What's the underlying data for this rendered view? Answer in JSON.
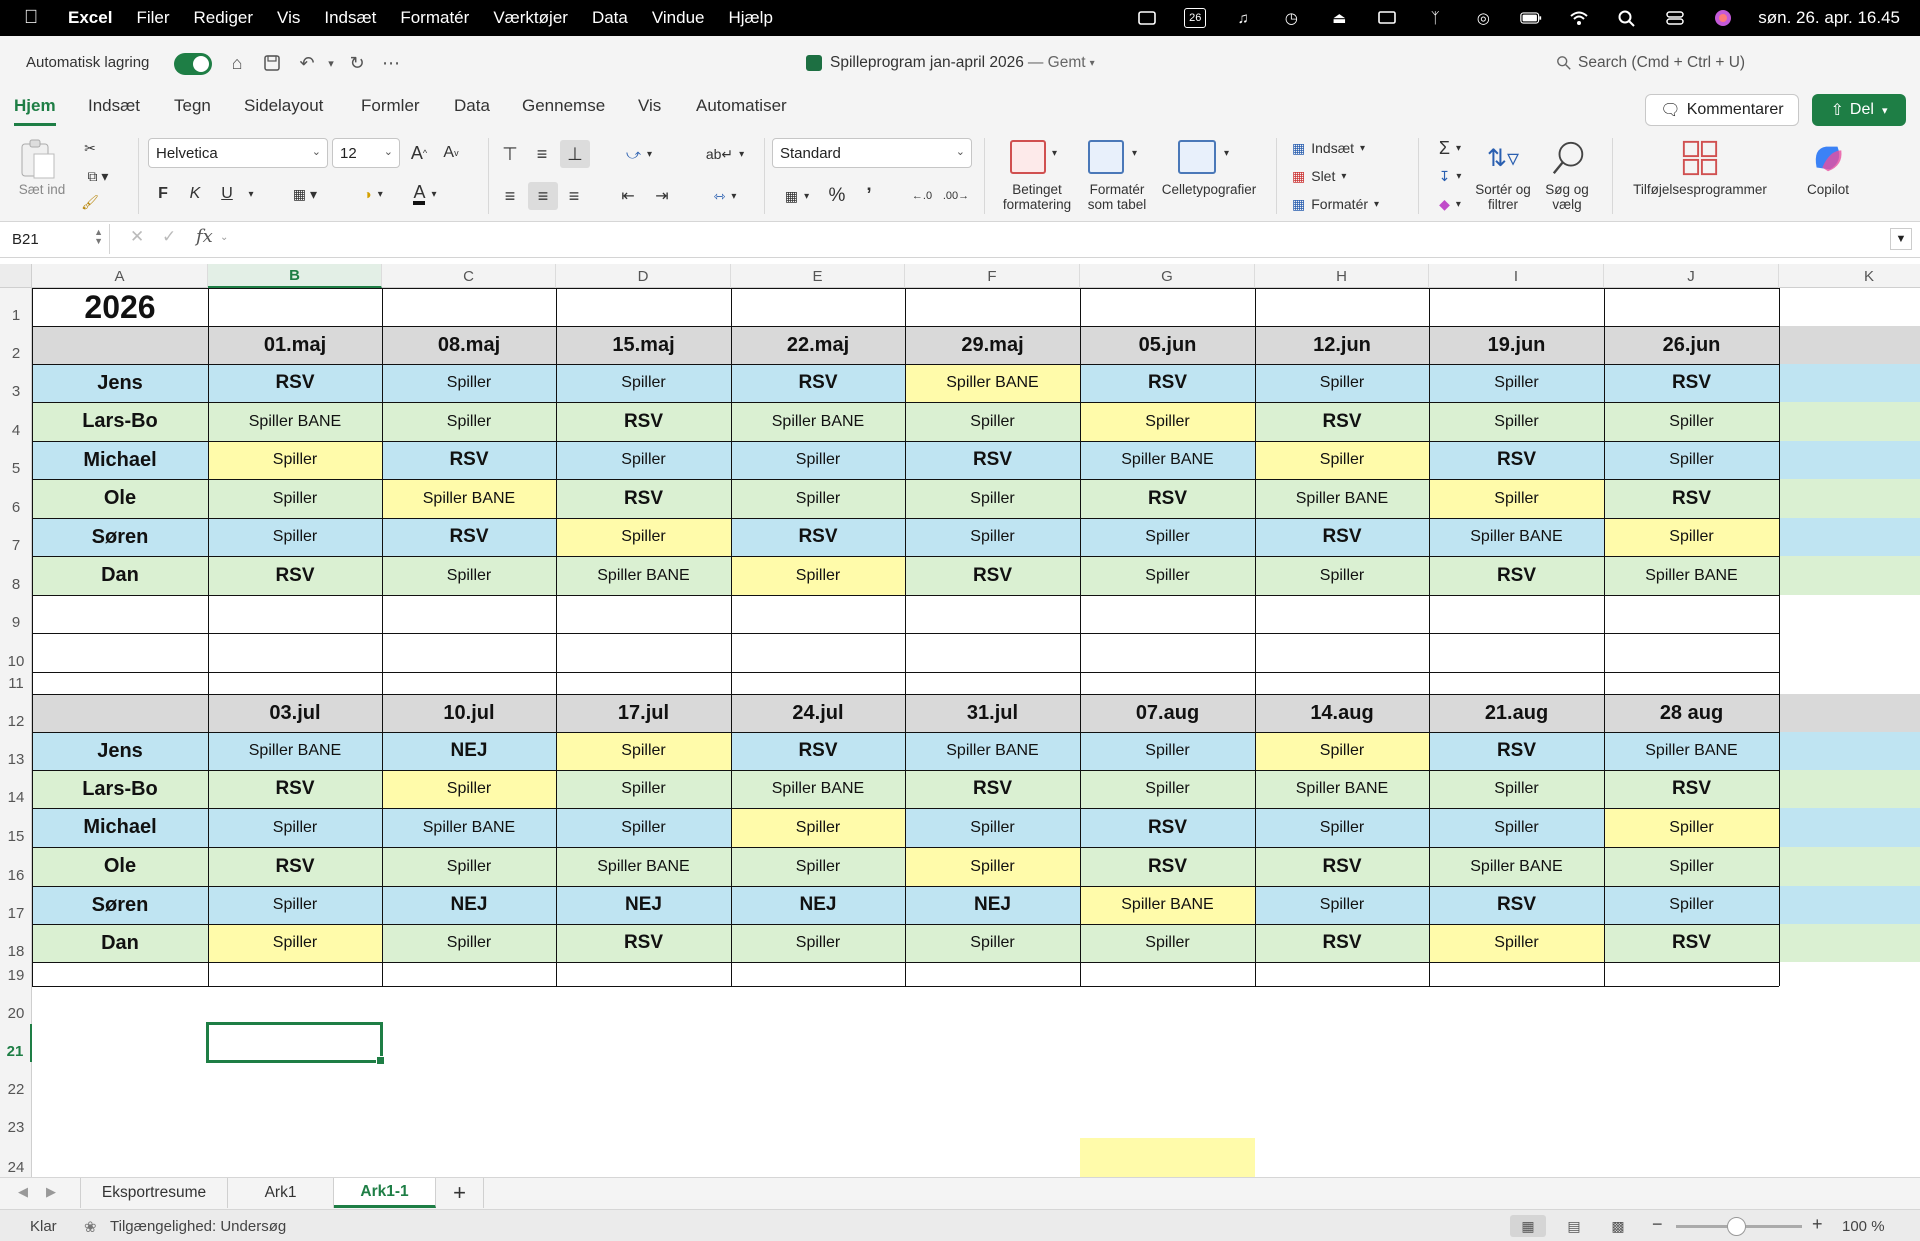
{
  "menubar": {
    "app": "Excel",
    "items": [
      "Filer",
      "Rediger",
      "Vis",
      "Indsæt",
      "Formatér",
      "Værktøjer",
      "Data",
      "Vindue",
      "Hjælp"
    ],
    "calendar_day": "26",
    "clock": "søn. 26. apr. 16.45"
  },
  "titlebar": {
    "autosave_label": "Automatisk lagring",
    "document_title": "Spilleprogram jan-april 2026",
    "saved_status": "— Gemt",
    "search_placeholder": "Search (Cmd + Ctrl + U)"
  },
  "ribbon_tabs": [
    "Hjem",
    "Indsæt",
    "Tegn",
    "Sidelayout",
    "Formler",
    "Data",
    "Gennemse",
    "Vis",
    "Automatiser"
  ],
  "active_tab": "Hjem",
  "comments_label": "Kommentarer",
  "share_label": "Del",
  "ribbon": {
    "paste_label": "Sæt ind",
    "font_name": "Helvetica",
    "font_size": "12",
    "bold": "F",
    "italic": "K",
    "underline": "U",
    "number_format": "Standard",
    "conditional_formatting": "Betinget formatering",
    "format_as_table": "Formatér som tabel",
    "cell_styles": "Celletypografier",
    "insert": "Indsæt",
    "delete": "Slet",
    "format": "Formatér",
    "sort_filter": "Sortér og filtrer",
    "find_select": "Søg og vælg",
    "addins": "Tilføjelsesprogrammer",
    "copilot": "Copilot"
  },
  "formula_bar": {
    "name_box": "B21",
    "fx": "fx",
    "formula": ""
  },
  "columns": [
    "A",
    "B",
    "C",
    "D",
    "E",
    "F",
    "G",
    "H",
    "I",
    "J",
    "K"
  ],
  "selected_column": "B",
  "rows": [
    "1",
    "2",
    "3",
    "4",
    "5",
    "6",
    "7",
    "8",
    "9",
    "10",
    "11",
    "12",
    "13",
    "14",
    "15",
    "16",
    "17",
    "18",
    "19",
    "20",
    "21",
    "22",
    "23",
    "24"
  ],
  "selected_row": "21",
  "sheet": {
    "year": "2026",
    "block1": {
      "dates": [
        "01.maj",
        "08.maj",
        "15.maj",
        "22.maj",
        "29.maj",
        "05.jun",
        "12.jun",
        "19.jun",
        "26.jun"
      ],
      "players": [
        {
          "name": "Jens",
          "values": [
            "RSV",
            "Spiller",
            "Spiller",
            "RSV",
            "Spiller BANE",
            "RSV",
            "Spiller",
            "Spiller",
            "RSV"
          ]
        },
        {
          "name": "Lars-Bo",
          "values": [
            "Spiller BANE",
            "Spiller",
            "RSV",
            "Spiller BANE",
            "Spiller",
            "Spiller",
            "RSV",
            "Spiller",
            "Spiller"
          ]
        },
        {
          "name": "Michael",
          "values": [
            "Spiller",
            "RSV",
            "Spiller",
            "Spiller",
            "RSV",
            "Spiller BANE",
            "Spiller",
            "RSV",
            "Spiller"
          ]
        },
        {
          "name": "Ole",
          "values": [
            "Spiller",
            "Spiller BANE",
            "RSV",
            "Spiller",
            "Spiller",
            "RSV",
            "Spiller BANE",
            "Spiller",
            "RSV"
          ]
        },
        {
          "name": "Søren",
          "values": [
            "Spiller",
            "RSV",
            "Spiller",
            "RSV",
            "Spiller",
            "Spiller",
            "RSV",
            "Spiller BANE",
            "Spiller"
          ]
        },
        {
          "name": "Dan",
          "values": [
            "RSV",
            "Spiller",
            "Spiller BANE",
            "Spiller",
            "RSV",
            "Spiller",
            "Spiller",
            "RSV",
            "Spiller BANE"
          ]
        }
      ]
    },
    "block2": {
      "dates": [
        "03.jul",
        "10.jul",
        "17.jul",
        "24.jul",
        "31.jul",
        "07.aug",
        "14.aug",
        "21.aug",
        "28 aug"
      ],
      "players": [
        {
          "name": "Jens",
          "values": [
            "Spiller BANE",
            "NEJ",
            "Spiller",
            "RSV",
            "Spiller BANE",
            "Spiller",
            "Spiller",
            "RSV",
            "Spiller BANE"
          ]
        },
        {
          "name": "Lars-Bo",
          "values": [
            "RSV",
            "Spiller",
            "Spiller",
            "Spiller BANE",
            "RSV",
            "Spiller",
            "Spiller BANE",
            "Spiller",
            "RSV"
          ]
        },
        {
          "name": "Michael",
          "values": [
            "Spiller",
            "Spiller BANE",
            "Spiller",
            "Spiller",
            "Spiller",
            "RSV",
            "Spiller",
            "Spiller",
            "Spiller"
          ]
        },
        {
          "name": "Ole",
          "values": [
            "RSV",
            "Spiller",
            "Spiller BANE",
            "Spiller",
            "Spiller",
            "RSV",
            "RSV",
            "Spiller BANE",
            "Spiller"
          ]
        },
        {
          "name": "Søren",
          "values": [
            "Spiller",
            "NEJ",
            "NEJ",
            "NEJ",
            "NEJ",
            "Spiller BANE",
            "Spiller",
            "RSV",
            "Spiller"
          ]
        },
        {
          "name": "Dan",
          "values": [
            "Spiller",
            "Spiller",
            "RSV",
            "Spiller",
            "Spiller",
            "Spiller",
            "RSV",
            "Spiller",
            "RSV"
          ]
        }
      ]
    },
    "colors": {
      "blue": "#bfe4f2",
      "green": "#daf0d2",
      "yellow": "#fffbaa",
      "header_gray": "#d9d9d9"
    }
  },
  "sheet_tabs": [
    "Eksportresume",
    "Ark1",
    "Ark1-1"
  ],
  "active_sheet": "Ark1-1",
  "status": {
    "ready": "Klar",
    "accessibility": "Tilgængelighed: Undersøg",
    "zoom": "100 %"
  }
}
